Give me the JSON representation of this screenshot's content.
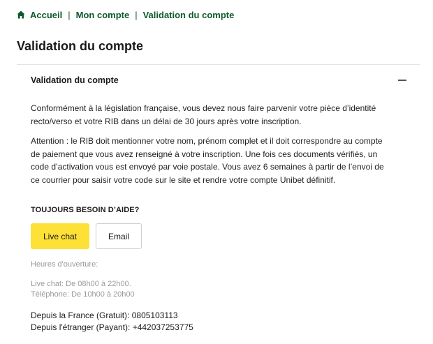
{
  "breadcrumb": {
    "home": "Accueil",
    "account": "Mon compte",
    "current": "Validation du compte",
    "separator": "|"
  },
  "page": {
    "title": "Validation du compte"
  },
  "accordion": {
    "title": "Validation du compte",
    "state": "expanded",
    "paragraph1": "Conformément à la législation française, vous devez nous faire parvenir votre pièce d’identité recto/verso et votre RIB dans un délai de 30 jours après votre inscription.",
    "paragraph2": "Attention : le RIB doit mentionner votre nom, prénom complet et il doit correspondre au compte de paiement que vous avez renseigné à votre inscription. Une fois ces documents vérifiés, un code d’activation vous est envoyé par voie postale. Vous avez 6 semaines à partir de l’envoi de ce courrier pour saisir votre code sur le site et rendre votre compte Unibet définitif."
  },
  "help": {
    "heading": "TOUJOURS BESOIN D’AIDE?",
    "live_chat_label": "Live chat",
    "email_label": "Email",
    "hours_label": "Heures d'ouverture:",
    "hours_chat": "Live chat: De 08h00 à 22h00.",
    "hours_phone": "Téléphone: De 10h00 à 20h00",
    "phone_france_label": "Depuis la France (Gratuit): ",
    "phone_france_number": "0805103113",
    "phone_abroad_label": "Depuis l'étranger (Payant): ",
    "phone_abroad_number": "+442037253775"
  },
  "colors": {
    "brand_green": "#0e5a2e",
    "accent_yellow": "#fde137",
    "muted_text": "#9a9a9a"
  },
  "icons": {
    "home": "home-icon",
    "collapse": "minus-icon"
  }
}
